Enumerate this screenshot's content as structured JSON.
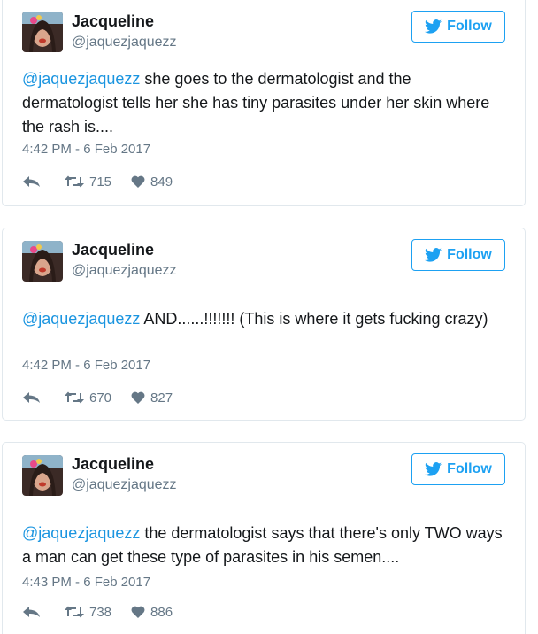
{
  "colors": {
    "accent": "#1da1f2",
    "mention": "#1b95e0",
    "meta": "#657786",
    "border": "#e1e8ed"
  },
  "icons": {
    "bird": "twitter-bird-icon",
    "reply": "reply-icon",
    "retweet": "retweet-icon",
    "like": "heart-icon"
  },
  "tweets": [
    {
      "author_name": "Jacqueline",
      "author_handle": "@jaquezjaquezz",
      "follow_label": "Follow",
      "mention": "@jaquezjaquezz",
      "body": " she goes to the dermatologist and the dermatologist tells her she has tiny parasites under her skin where the rash is....",
      "timestamp": "4:42 PM - 6 Feb 2017",
      "retweets": "715",
      "likes": "849"
    },
    {
      "author_name": "Jacqueline",
      "author_handle": "@jaquezjaquezz",
      "follow_label": "Follow",
      "mention": "@jaquezjaquezz",
      "body": " AND......!!!!!!! (This is where it gets fucking crazy)",
      "timestamp": "4:42 PM - 6 Feb 2017",
      "retweets": "670",
      "likes": "827"
    },
    {
      "author_name": "Jacqueline",
      "author_handle": "@jaquezjaquezz",
      "follow_label": "Follow",
      "mention": "@jaquezjaquezz",
      "body": " the dermatologist says that there's only TWO ways a man can get these type of parasites in his semen....",
      "timestamp": "4:43 PM - 6 Feb 2017",
      "retweets": "738",
      "likes": "886"
    }
  ]
}
